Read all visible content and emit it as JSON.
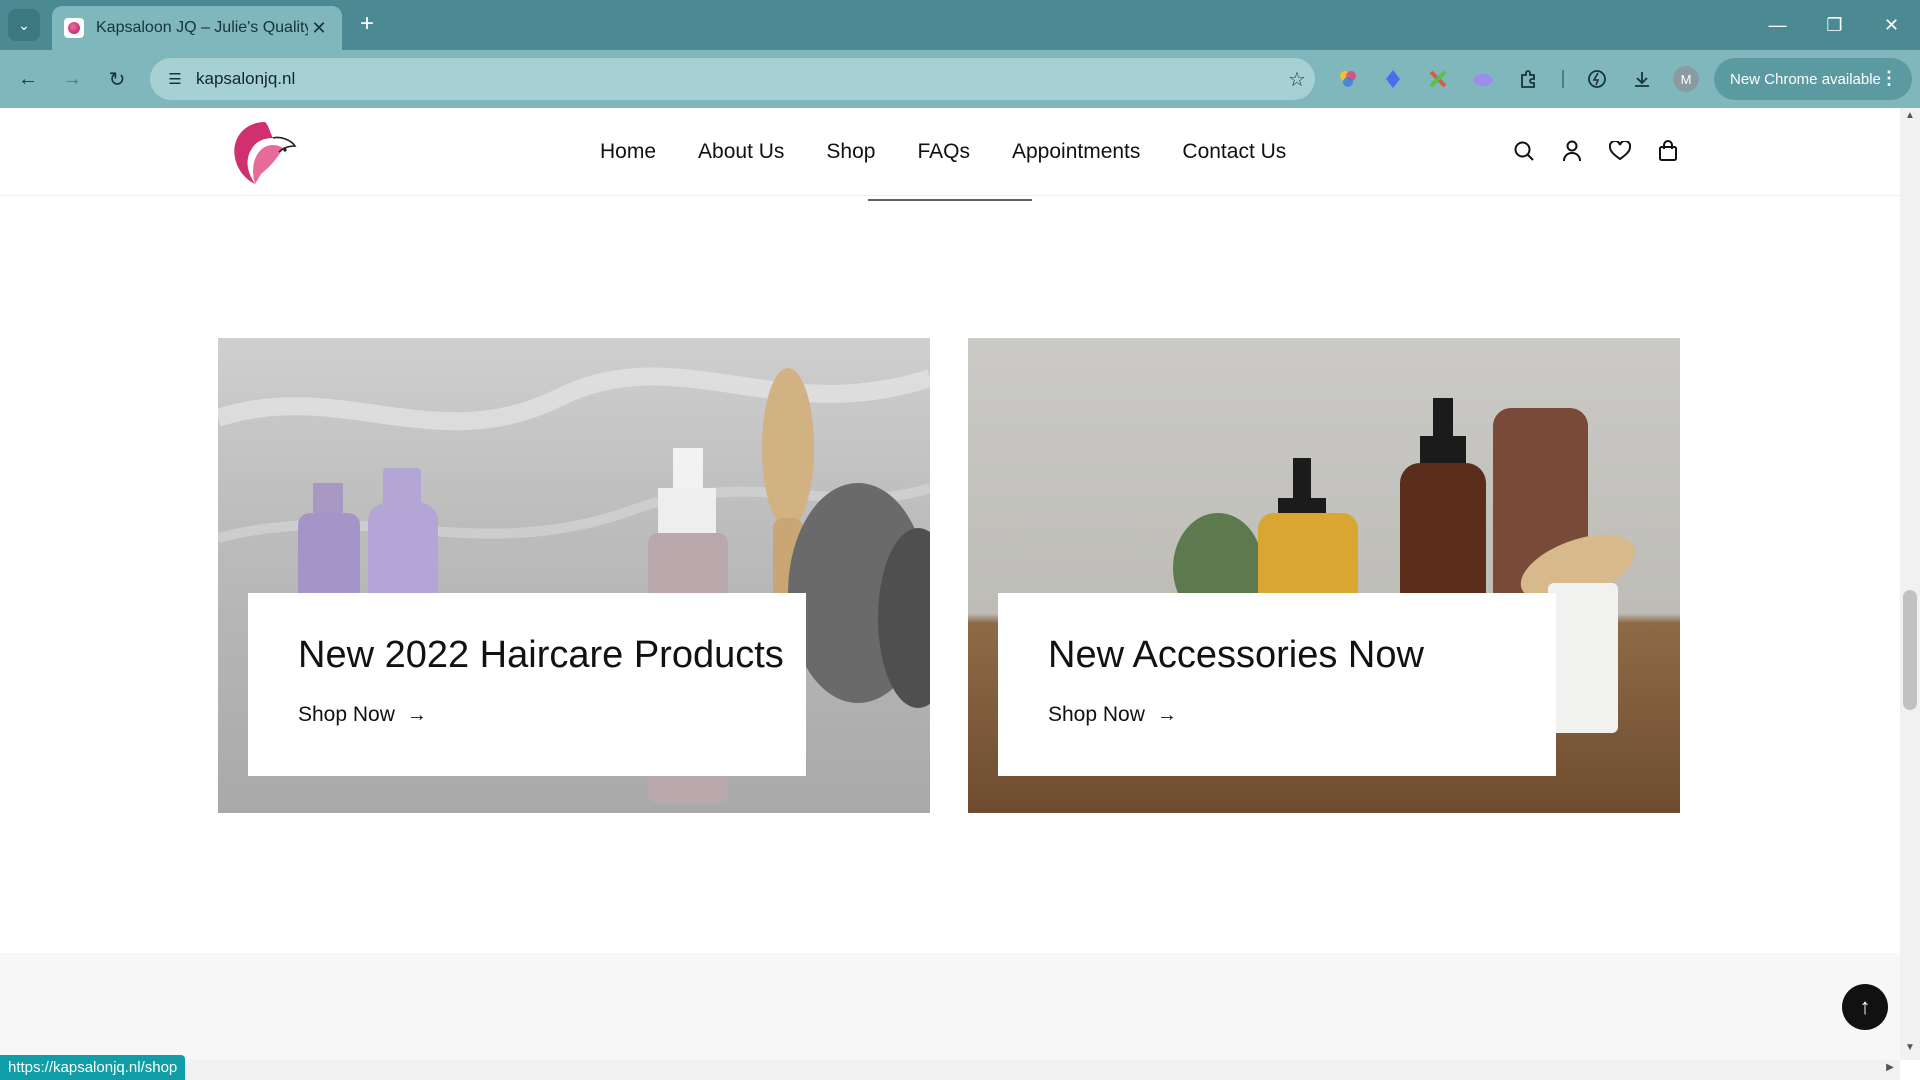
{
  "browser": {
    "tab_title": "Kapsaloon JQ – Julie's Quality",
    "url": "kapsalonjq.nl",
    "profile_initial": "M",
    "update_label": "New Chrome available",
    "status_url": "https://kapsalonjq.nl/shop"
  },
  "nav": {
    "items": [
      "Home",
      "About Us",
      "Shop",
      "FAQs",
      "Appointments",
      "Contact Us"
    ]
  },
  "promos": [
    {
      "title": "New 2022 Haircare Products",
      "link": "Shop Now"
    },
    {
      "title": "New Accessories Now",
      "link": "Shop Now"
    }
  ],
  "colors": {
    "chrome_tabbar": "#4b8a93",
    "chrome_toolbar": "#7fb7bd",
    "logo_pink": "#d1306e",
    "status_bar": "#0f9ea8"
  }
}
